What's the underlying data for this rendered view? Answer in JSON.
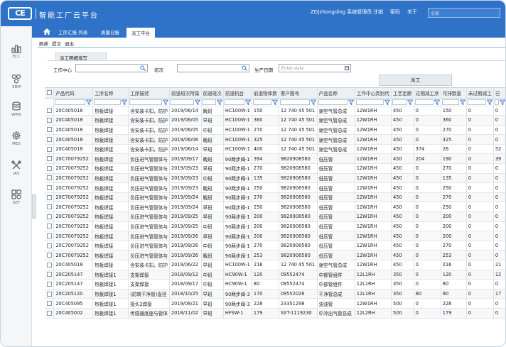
{
  "header": {
    "logo_text": "CE",
    "app_title": "智能工厂云平台",
    "user": "ZD|zhongding 系统管理员",
    "links": [
      "注销",
      "密码",
      "关于"
    ],
    "search_placeholder": "全部"
  },
  "nav": {
    "tabs": [
      "工序汇报-列表",
      "质量日报",
      "派工平台"
    ],
    "active_tab": 2
  },
  "sidebar": {
    "items": [
      {
        "label": "ECC",
        "icon": "bar-chart-icon"
      },
      {
        "label": "SRM",
        "icon": "network-icon"
      },
      {
        "label": "WMS",
        "icon": "database-icon"
      },
      {
        "label": "MES",
        "icon": "gear-icon"
      },
      {
        "label": "IAS",
        "icon": "tools-icon"
      },
      {
        "label": "SET",
        "icon": "grid-settings-icon"
      }
    ]
  },
  "toolbar": {
    "buttons": [
      "刷新",
      "提交",
      "退出"
    ]
  },
  "subtab": {
    "label": "派工明细填写"
  },
  "filters": {
    "work_center_label": "工作中心",
    "shift_label": "班次",
    "date_label": "生产日期",
    "date_placeholder": "Enter date"
  },
  "dispatch_button": "派工",
  "grid": {
    "columns": [
      "产品代码",
      "工序名称",
      "工序描述",
      "前道班次所属",
      "前道班次",
      "前道机台",
      "前道物体数",
      "客户图号",
      "产品名称",
      "工作中心类别代",
      "工艺定额",
      "过期减工序",
      "可排数量",
      "未过期减工",
      "已"
    ],
    "filter_placeholder": "Enter",
    "rows": [
      [
        "20C405018",
        "热板焊接",
        "含安装卡扣，防护",
        "2019/06/14",
        "晚班",
        "HC100W-1",
        "150",
        "12 740 45 501",
        "谢空气管总成",
        "12W1RH",
        "450",
        "0",
        "150",
        "0",
        "0"
      ],
      [
        "20C405018",
        "热板焊接",
        "含安装卡扣，防护",
        "2019/06/05",
        "早班",
        "HC100W-1",
        "360",
        "12 740 45 501",
        "谢空气管总成",
        "12W1RH",
        "450",
        "0",
        "360",
        "0",
        "0"
      ],
      [
        "20C405018",
        "热板焊接",
        "含安装卡扣，防护",
        "2019/06/05",
        "中班",
        "HC100W-1",
        "270",
        "12 740 45 501",
        "谢空气管总成",
        "12W1RH",
        "450",
        "0",
        "270",
        "0",
        "0"
      ],
      [
        "20C405018",
        "热板焊接",
        "含安装卡扣，防护",
        "2019/06/06",
        "晚班",
        "HC100W-1",
        "325",
        "12 740 45 501",
        "谢空气管总成",
        "12W1RH",
        "450",
        "0",
        "325",
        "0",
        "0"
      ],
      [
        "20C405018",
        "热板焊接",
        "含安装卡扣，防护",
        "2019/06/14",
        "早班",
        "HC100W-1",
        "400",
        "12 740 45 501",
        "谢空气管总成",
        "12W1RH",
        "450",
        "374",
        "26",
        "0",
        "52"
      ],
      [
        "20C70079252",
        "热板焊接",
        "负压进气管管体与",
        "2019/09/17",
        "晚班",
        "90两步阀-1",
        "394",
        "9820908580",
        "低压管",
        "12W1RH",
        "450",
        "204",
        "190",
        "0",
        "39"
      ],
      [
        "20C70079252",
        "热板焊接",
        "负压进气管管体与",
        "2019/09/23",
        "早班",
        "90两步阀-1",
        "270",
        "9820908580",
        "低压管",
        "12W1RH",
        "450",
        "0",
        "270",
        "0",
        "0"
      ],
      [
        "20C70079252",
        "热板焊接",
        "负压进气管管体与",
        "2019/09/23",
        "中班",
        "90两步阀-1",
        "135",
        "9820908580",
        "低压管",
        "12W1RH",
        "450",
        "0",
        "135",
        "0",
        "0"
      ],
      [
        "20C70079252",
        "热板焊接",
        "负压进气管管体与",
        "2019/09/23",
        "晚班",
        "90两步阀-1",
        "250",
        "9820908580",
        "低压管",
        "12W1RH",
        "450",
        "0",
        "250",
        "0",
        "0"
      ],
      [
        "20C70079252",
        "热板焊接",
        "负压进气管管体与",
        "2019/09/24",
        "晚班",
        "90两步阀-1",
        "270",
        "9820908580",
        "低压管",
        "12W1RH",
        "450",
        "0",
        "270",
        "0",
        "0"
      ],
      [
        "20C70079252",
        "热板焊接",
        "负压进气管管体与",
        "2019/09/24",
        "早班",
        "90两步阀-1",
        "250",
        "9820908580",
        "低压管",
        "12W1RH",
        "450",
        "0",
        "250",
        "0",
        "0"
      ],
      [
        "20C70079252",
        "热板焊接",
        "负压进气管管体与",
        "2019/09/25",
        "早班",
        "90两步阀-1",
        "200",
        "9820908580",
        "低压管",
        "12W1RH",
        "450",
        "0",
        "200",
        "0",
        "0"
      ],
      [
        "20C70079252",
        "热板焊接",
        "负压进气管管体与",
        "2019/09/25",
        "中班",
        "90两步阀-1",
        "200",
        "9820908580",
        "低压管",
        "12W1RH",
        "450",
        "0",
        "200",
        "0",
        "0"
      ],
      [
        "20C70079252",
        "热板焊接",
        "负压进气管管体与",
        "2019/09/26",
        "早班",
        "90两步阀-1",
        "200",
        "9820908580",
        "低压管",
        "12W1RH",
        "450",
        "0",
        "200",
        "0",
        "0"
      ],
      [
        "20C70079252",
        "热板焊接",
        "负压进气管管体与",
        "2019/09/26",
        "中班",
        "90两步阀-1",
        "270",
        "9820908580",
        "低压管",
        "12W1RH",
        "450",
        "0",
        "270",
        "0",
        "0"
      ],
      [
        "20C70079252",
        "热板焊接",
        "负压进气管管体与",
        "2019/09/26",
        "晚班",
        "90两步阀-1",
        "253",
        "9820908580",
        "低压管",
        "12W1RH",
        "450",
        "0",
        "253",
        "0",
        "0"
      ],
      [
        "20C405018",
        "热板焊接",
        "含安装卡扣，防护",
        "2019/06/22",
        "早班",
        "HC100W-1",
        "216",
        "12 740 45 501",
        "谢空气管总成",
        "12W1RH",
        "450",
        "0",
        "216",
        "0",
        "21"
      ],
      [
        "20C205147",
        "热板焊接1",
        "支架焊接",
        "2018/09/12",
        "中班",
        "HC90W-1",
        "120",
        "09552474",
        "中部管组件",
        "12L1RH",
        "350",
        "0",
        "120",
        "0",
        "12"
      ],
      [
        "20C205147",
        "热板焊接1",
        "支架焊接",
        "2018/09/17",
        "中班",
        "HC90W-1",
        "80",
        "09552474",
        "中部管组件",
        "12L1RH",
        "350",
        "0",
        "80",
        "0",
        "0"
      ],
      [
        "20C205120",
        "热板焊接1",
        "(前转干净管)直径",
        "2018/10/25",
        "早班",
        "90两步阀-3",
        "170",
        "09552026",
        "干净管总成",
        "12L1RH",
        "350",
        "80",
        "90",
        "0",
        "17"
      ],
      [
        "20C405095",
        "热板焊接1",
        "接头2焊接",
        "2019/08/21",
        "早班",
        "90两步阀-3",
        "228",
        "23351298",
        "油油管",
        "12W1RH",
        "500",
        "0",
        "228",
        "0",
        "0"
      ],
      [
        "20C405002",
        "热板焊接1",
        "传感器底座与管体",
        "2018/11/02",
        "早班",
        "HFSW-1",
        "179",
        "SXT-1119230",
        "中冷出气管总成",
        "12L2RH",
        "500",
        "0",
        "179",
        "0",
        "0"
      ]
    ]
  }
}
